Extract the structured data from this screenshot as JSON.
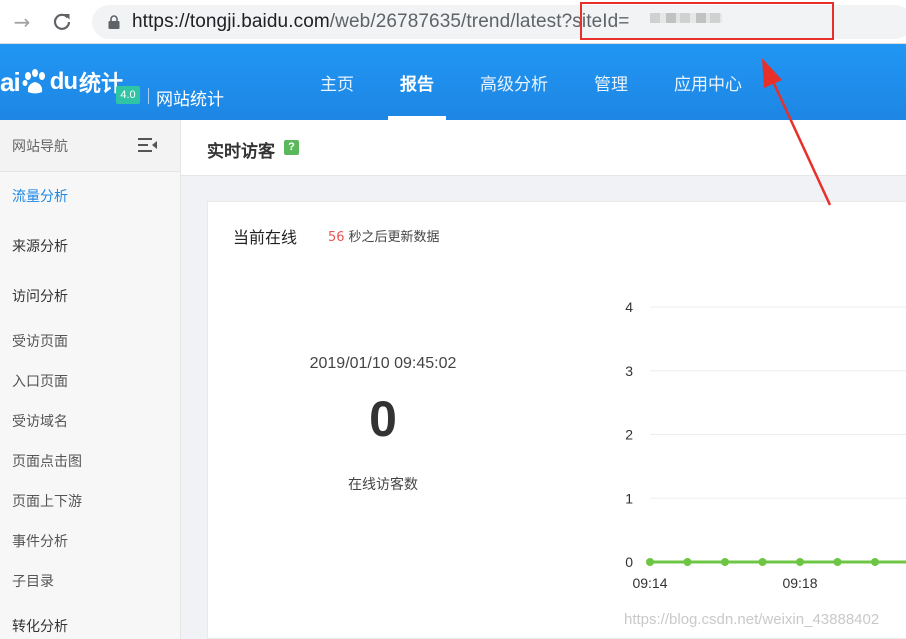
{
  "browser": {
    "url_host": "https://tongji.baidu.com",
    "url_path": "/web/26787635/trend/latest?siteId="
  },
  "header": {
    "logo_bai": "ai",
    "logo_du": "du",
    "logo_tongji": "统计",
    "version": "4.0",
    "site_name": "网站统计",
    "nav": [
      {
        "label": "主页",
        "active": false
      },
      {
        "label": "报告",
        "active": true
      },
      {
        "label": "高级分析",
        "active": false
      },
      {
        "label": "管理",
        "active": false
      },
      {
        "label": "应用中心",
        "active": false
      }
    ]
  },
  "sidebar": {
    "title": "网站导航",
    "items": [
      {
        "label": "流量分析",
        "active": true
      },
      {
        "label": "来源分析"
      },
      {
        "label": "访问分析"
      },
      {
        "label": "受访页面"
      },
      {
        "label": "入口页面"
      },
      {
        "label": "受访域名"
      },
      {
        "label": "页面点击图"
      },
      {
        "label": "页面上下游"
      },
      {
        "label": "事件分析"
      },
      {
        "label": "子目录"
      },
      {
        "label": "转化分析"
      }
    ]
  },
  "page": {
    "title": "实时访客",
    "help": "?"
  },
  "realtime": {
    "title": "当前在线",
    "countdown": "56",
    "countdown_suffix": "秒之后更新数据",
    "timestamp": "2019/01/10 09:45:02",
    "online_count": "0",
    "online_label": "在线访客数"
  },
  "chart_data": {
    "type": "line",
    "yticks": [
      "4",
      "3",
      "2",
      "1",
      "0"
    ],
    "ylim": [
      0,
      4
    ],
    "xticks": [
      "09:14",
      "09:18"
    ],
    "series": [
      {
        "values": [
          0,
          0,
          0,
          0,
          0,
          0,
          0,
          0
        ]
      }
    ],
    "grid": true,
    "color": "#6cc644"
  },
  "watermark": "https://blog.csdn.net/weixin_43888402",
  "colors": {
    "header_blue": "#1e88e5",
    "accent_red": "#e8302b",
    "line_green": "#6cc644"
  }
}
